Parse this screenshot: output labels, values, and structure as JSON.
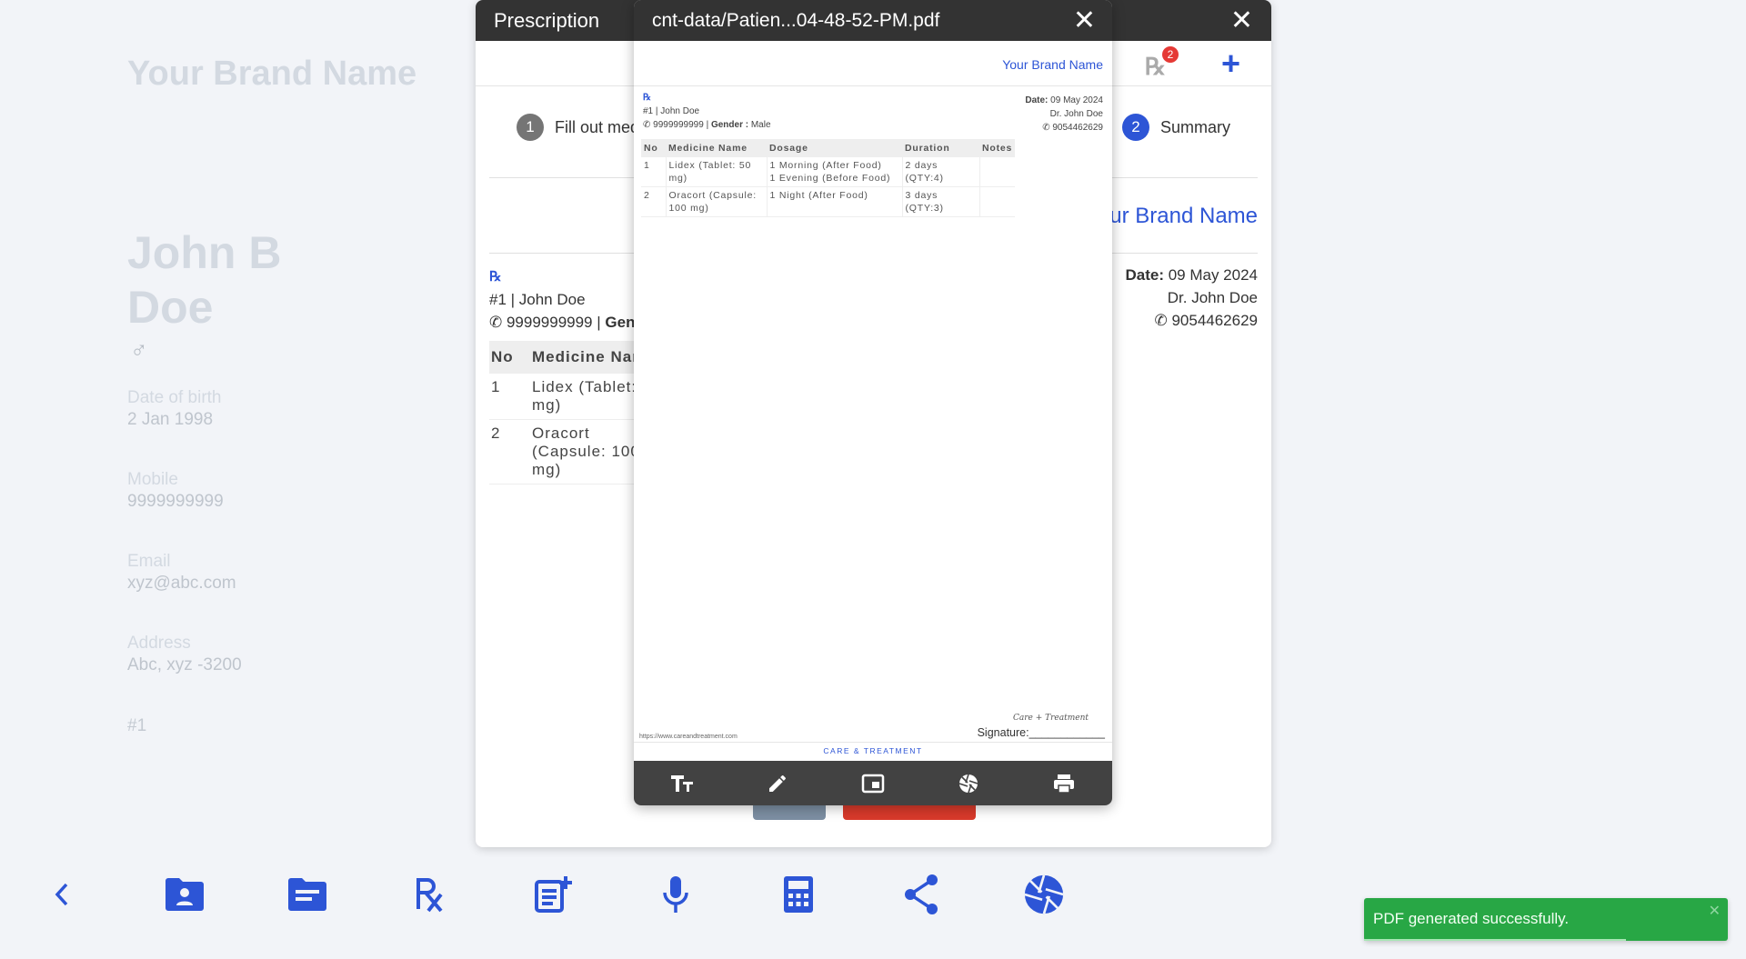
{
  "background": {
    "brand": "Your Brand Name",
    "patient": {
      "name": "John B Doe",
      "gender_icon": "male-icon",
      "fields": [
        {
          "label": "Date of birth",
          "value": "2 Jan 1998"
        },
        {
          "label": "Mobile",
          "value": "9999999999"
        },
        {
          "label": "Email",
          "value": "xyz@abc.com"
        },
        {
          "label": "Address",
          "value": "Abc, xyz -3200"
        }
      ],
      "id": "#1"
    }
  },
  "prescription_modal": {
    "title": "Prescription",
    "rx_count": "2",
    "steps": [
      {
        "num": "1",
        "label": "Fill out medicines"
      },
      {
        "num": "2",
        "label": "Summary"
      }
    ],
    "brand": "Your Brand Name",
    "rx_symbol": "℞",
    "patient_line": "#1 | John Doe",
    "phone_line": "9999999999 | ",
    "gender_label": "Gender :",
    "gender_value": " Male",
    "date_label": "Date:",
    "date_value": " 09 May 2024",
    "doctor": "Dr. John Doe",
    "doctor_phone": "9054462629",
    "table_headers": [
      "No",
      "Medicine Name",
      "Dosage",
      "Duration",
      "Notes"
    ],
    "rows": [
      {
        "no": "1",
        "medicine": "Lidex (Tablet: 50 mg)",
        "dosage": [
          "1 Morning (After Food)",
          "1 Evening (Before Food)"
        ],
        "duration": [
          "2 days",
          "(QTY:4)"
        ],
        "notes": ""
      },
      {
        "no": "2",
        "medicine": "Oracort (Capsule: 100 mg)",
        "dosage": [
          "1 Night (After Food)"
        ],
        "duration": [
          "3 days",
          "(QTY:3)"
        ],
        "notes": ""
      }
    ]
  },
  "pdf_viewer": {
    "title": "cnt-data/Patien...04-48-52-PM.pdf",
    "brand": "Your Brand Name",
    "footer_url": "https://www.careandtreatment.com",
    "signature_label": "Signature:____________",
    "signature_script": "Care + Treatment",
    "footer_brand": "CARE & TREATMENT",
    "tools": [
      {
        "name": "text-size-icon",
        "label": "Text size"
      },
      {
        "name": "pencil-icon",
        "label": "Annotate"
      },
      {
        "name": "picture-in-picture-icon",
        "label": "Picture in picture"
      },
      {
        "name": "camera-shutter-icon",
        "label": "Capture"
      },
      {
        "name": "print-icon",
        "label": "Print"
      }
    ]
  },
  "bottom_toolbar": [
    "back-icon",
    "patient-folder-icon",
    "notes-folder-icon",
    "prescription-icon",
    "add-note-icon",
    "microphone-icon",
    "calculator-icon",
    "share-icon",
    "camera-shutter-icon"
  ],
  "toast": {
    "message": "PDF generated successfully.",
    "progress_remaining": 0.72,
    "color": "#28a745"
  },
  "colors": {
    "accent": "#2d55d6",
    "header": "#333333",
    "danger": "#d93a2b"
  }
}
